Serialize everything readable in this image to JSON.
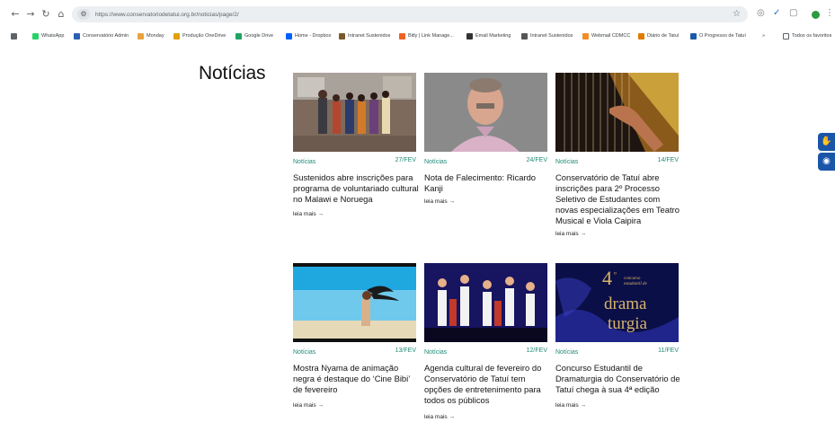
{
  "browser": {
    "url": "https://www.conservatoriodetatui.org.br/noticias/page/2/",
    "bookmarks": [
      {
        "label": "WhatsApp",
        "color": "#25d366"
      },
      {
        "label": "Conservatório Admin",
        "color": "#2b5fb3"
      },
      {
        "label": "Monday",
        "color": "#e8a33d"
      },
      {
        "label": "Produção OneDrive",
        "color": "#e2a100"
      },
      {
        "label": "Google Drive",
        "color": "#1fa463"
      },
      {
        "label": "Home - Dropbox",
        "color": "#0061fe"
      },
      {
        "label": "Intranet Sustenidos",
        "color": "#7a5a2a"
      },
      {
        "label": "Bitly | Link Manage...",
        "color": "#ee6123"
      },
      {
        "label": "Email Marketing",
        "color": "#333333"
      },
      {
        "label": "Intranet Sustenidos",
        "color": "#555555"
      },
      {
        "label": "Webmail CDMCC",
        "color": "#f28c28"
      },
      {
        "label": "Diário de Tatuí",
        "color": "#e07b00"
      },
      {
        "label": "O Progresso de Tatuí",
        "color": "#1a5aa8"
      }
    ],
    "bookmarks_more": "»",
    "all_bookmarks": "Todos os favoritos"
  },
  "page": {
    "heading": "Notícias",
    "read_more": "leia mais →",
    "posts": [
      {
        "category": "Notícias",
        "date": "27/FEV",
        "title": "Sustenidos abre inscrições para programa de voluntariado cultural no Malawi e Noruega"
      },
      {
        "category": "Notícias",
        "date": "24/FEV",
        "title": "Nota de Falecimento: Ricardo Kanji"
      },
      {
        "category": "Notícias",
        "date": "14/FEV",
        "title": "Conservatório de Tatuí abre inscrições para 2º Processo Seletivo de Estudantes com novas especializações em Teatro Musical e Viola Caipira"
      },
      {
        "category": "Notícias",
        "date": "13/FEV",
        "title": "Mostra Nyama de animação negra é destaque do ‘Cine Bibi’ de fevereiro"
      },
      {
        "category": "Notícias",
        "date": "12/FEV",
        "title": "Agenda cultural de fevereiro do Conservatório de Tatuí tem opções de entretenimento para todos os públicos"
      },
      {
        "category": "Notícias",
        "date": "11/FEV",
        "title": "Concurso Estudantil de Dramaturgia do Conservatório de Tatuí chega à sua 4ª edição"
      }
    ],
    "poster_text": {
      "number": "4",
      "ordinal": "º",
      "line1": "concurso",
      "line2": "estudantil de",
      "word1": "drama",
      "word2": "turgia"
    }
  },
  "colors": {
    "accent_green": "#1f8a77",
    "side_button_blue": "#1a55a8"
  }
}
